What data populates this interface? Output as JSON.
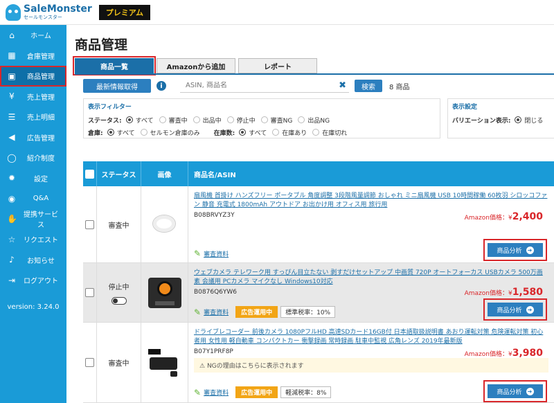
{
  "brand": {
    "name": "SaleMonster",
    "sub": "セールモンスター",
    "plan": "プレミアム"
  },
  "sidebar": {
    "items": [
      {
        "label": "ホーム",
        "icon": "home-icon",
        "glyph": "⌂"
      },
      {
        "label": "倉庫管理",
        "icon": "warehouse-icon",
        "glyph": "▦"
      },
      {
        "label": "商品管理",
        "icon": "gift-icon",
        "glyph": "▣"
      },
      {
        "label": "売上管理",
        "icon": "yen-icon",
        "glyph": "¥"
      },
      {
        "label": "売上明細",
        "icon": "document-icon",
        "glyph": "☰"
      },
      {
        "label": "広告管理",
        "icon": "megaphone-icon",
        "glyph": "◀"
      },
      {
        "label": "紹介制度",
        "icon": "chat-icon",
        "glyph": "◯"
      },
      {
        "label": "設定",
        "icon": "gear-icon",
        "glyph": "✹"
      },
      {
        "label": "Q&A",
        "icon": "comments-icon",
        "glyph": "◉"
      },
      {
        "label": "提携サービス",
        "icon": "handshake-icon",
        "glyph": "✋"
      },
      {
        "label": "リクエスト",
        "icon": "star-icon",
        "glyph": "☆"
      },
      {
        "label": "お知らせ",
        "icon": "bell-icon",
        "glyph": "♪"
      },
      {
        "label": "ログアウト",
        "icon": "logout-icon",
        "glyph": "⇥"
      }
    ],
    "version": "version: 3.24.0"
  },
  "page": {
    "title": "商品管理"
  },
  "tabs": [
    "商品一覧",
    "Amazonから追加",
    "レポート"
  ],
  "actions": {
    "refresh": "最新情報取得",
    "info": "i",
    "search_placeholder": "ASIN, 商品名",
    "search_button": "検索",
    "count": "8 商品"
  },
  "filters": {
    "title": "表示フィルター",
    "status_label": "ステータス:",
    "status_options": [
      "すべて",
      "審査中",
      "出品中",
      "停止中",
      "審査NG",
      "出品NG"
    ],
    "warehouse_label": "倉庫:",
    "warehouse_options": [
      "すべて",
      "セルモン倉庫のみ"
    ],
    "stock_label": "在庫数:",
    "stock_options": [
      "すべて",
      "在庫あり",
      "在庫切れ"
    ]
  },
  "display": {
    "title": "表示設定",
    "variation_label": "バリエーション表示:",
    "variation_option": "閉じる"
  },
  "table": {
    "headers": [
      "ステータス",
      "画像",
      "商品名/ASIN"
    ],
    "price_prefix": "Amazon価格：¥",
    "doc_label": "審査資料",
    "analyze_label": "商品分析",
    "rows": [
      {
        "status": "審査中",
        "title": "扇風機 首掛け ハンズフリー ポータブル 角度調整 3段階風量調節 おしゃれ ミニ扇風機 USB 10時間稼働 60枚羽 シロッコファン 静音 充電式 1800mAh アウトドア お出かけ用 オフィス用 旅行用",
        "asin": "B08BRVYZ3Y",
        "price": "2,400"
      },
      {
        "status": "停止中",
        "title": "ウェブカメラ テレワーク用 すっぴん目立たない 剥すだけセットアップ 中画質 720P オートフォーカス USBカメラ 500万画素 会議用 PCカメラ マイクなし Windows10対応",
        "asin": "B0876Q6YW6",
        "price": "1,580",
        "ad_badge": "広告運用中",
        "tax_badge": "標準税率：10%"
      },
      {
        "status": "審査中",
        "title": "ドライブレコーダー 前後カメラ 1080PフルHD 高速SDカード16GB付 日本語取扱説明書 あおり運転対策 危険運転対策 初心者用 女性用 軽自動車 コンパクトカー 衝撃録画 常時録画 駐車中監視 広角レンズ 2019年最新版",
        "asin": "B07Y1PRF8P",
        "price": "3,980",
        "ng_note": "NGの理由はこちらに表示されます",
        "ad_badge": "広告運用中",
        "tax_badge": "軽減税率：8%"
      }
    ]
  },
  "colors": {
    "sidebar": "#1a9bd7",
    "accent": "#1b6fa8",
    "highlight": "#d9262a",
    "price": "#d9262a",
    "ad_badge": "#f2a516"
  }
}
